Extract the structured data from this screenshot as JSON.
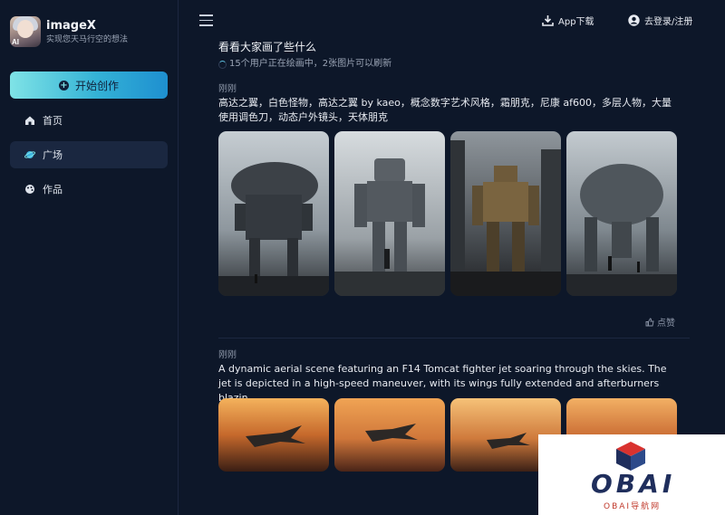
{
  "brand": {
    "name": "imageX",
    "slogan": "实现您天马行空的想法"
  },
  "sidebar": {
    "create_label": "开始创作",
    "items": [
      {
        "label": "首页",
        "icon": "home-icon",
        "active": false
      },
      {
        "label": "广场",
        "icon": "planet-icon",
        "active": true
      },
      {
        "label": "作品",
        "icon": "palette-icon",
        "active": false
      }
    ]
  },
  "header": {
    "app_download": "App下载",
    "login": "去登录/注册"
  },
  "feed": {
    "title": "看看大家画了些什么",
    "status": "15个用户正在绘画中，2张图片可以刷新",
    "posts": [
      {
        "time": "刚刚",
        "prompt": "高达之翼，白色怪物，高达之翼 by kaeo，概念数字艺术风格，霜朋克，尼康 af600，多层人物，大量使用调色刀，动态户外镜头，天体朋克",
        "like_label": "点赞"
      },
      {
        "time": "刚刚",
        "prompt": "A dynamic aerial scene featuring an F14 Tomcat fighter jet soaring through the skies. The jet is depicted in a high-speed maneuver, with its wings fully extended and afterburners blazin..."
      }
    ]
  },
  "watermark": {
    "text": "OBAI",
    "sub": "OBAI导航网"
  },
  "colors": {
    "background": "#0d1729",
    "accent_start": "#7fe3e6",
    "accent_end": "#1e8fd0",
    "nav_active": "#1a2740"
  }
}
